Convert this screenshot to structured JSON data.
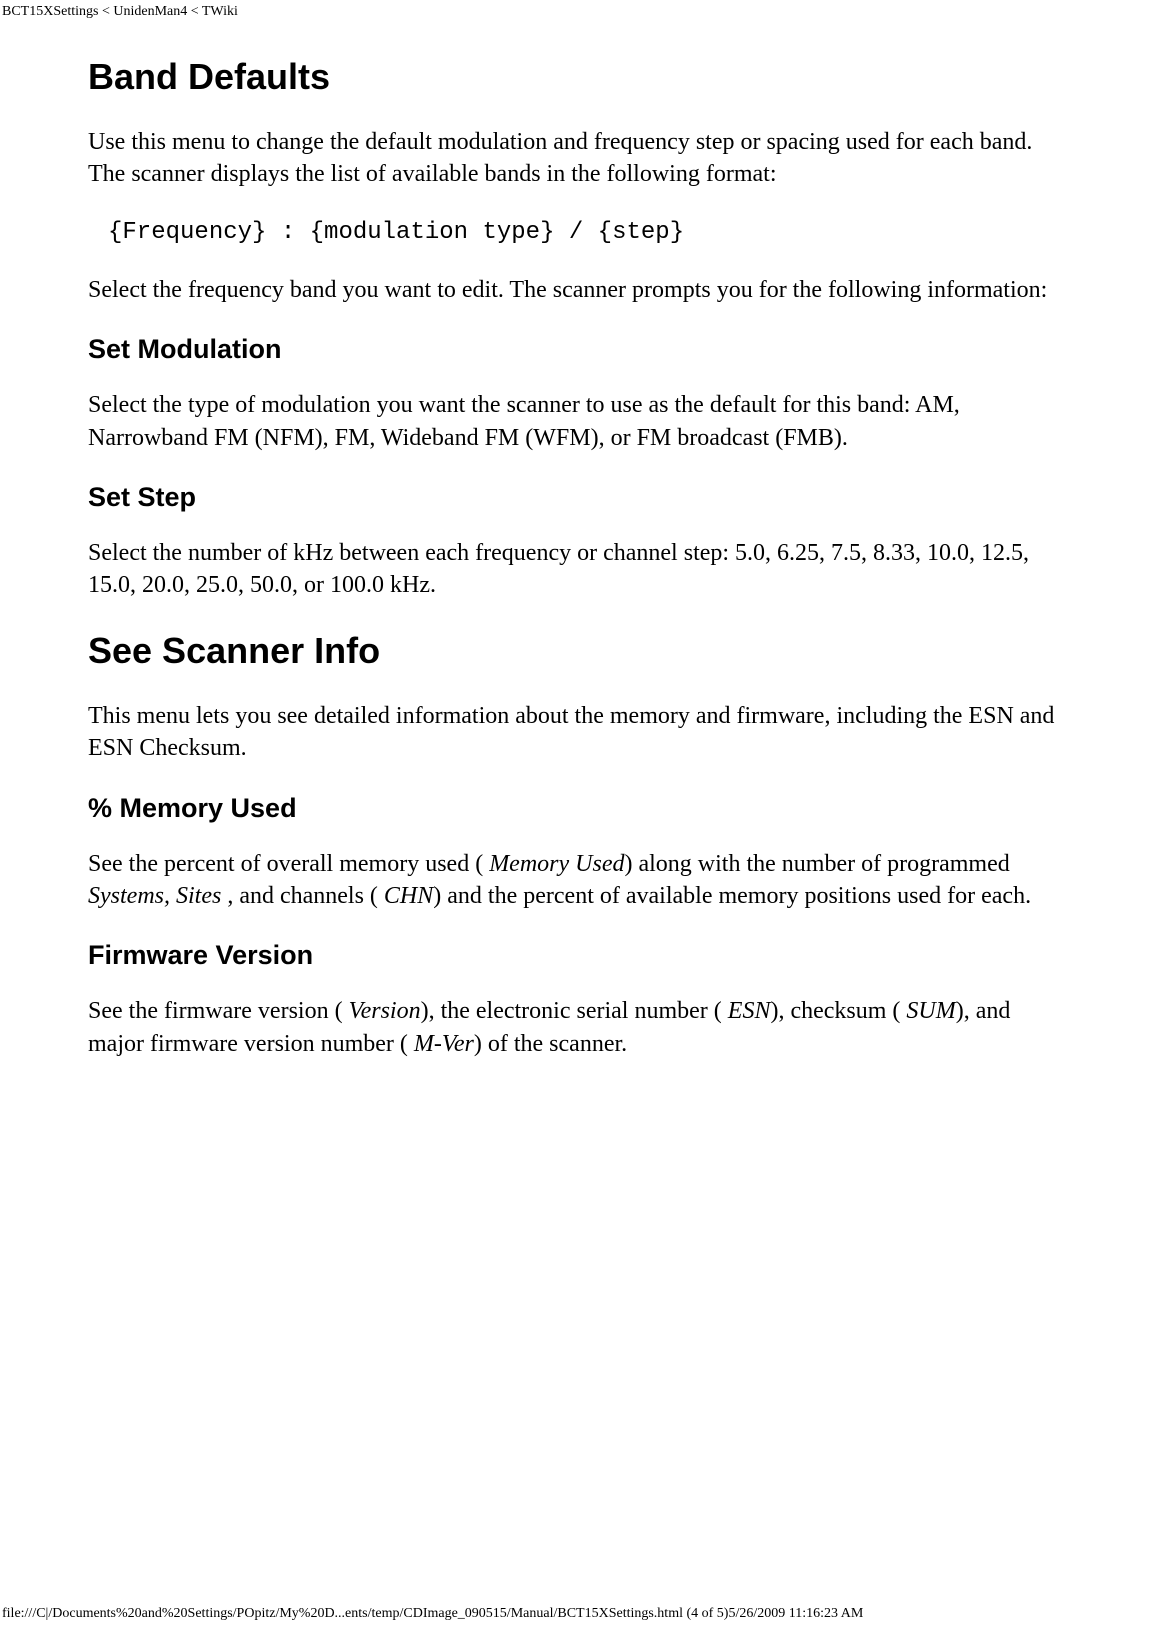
{
  "header": {
    "breadcrumb": "BCT15XSettings < UnidenMan4 < TWiki"
  },
  "sections": {
    "band_defaults": {
      "title": "Band Defaults",
      "intro": "Use this menu to change the default modulation and frequency step or spacing used for each band. The scanner displays the list of available bands in the following format:",
      "code": "{Frequency} : {modulation type} / {step}",
      "prompt": "Select the frequency band you want to edit. The scanner prompts you for the following information:",
      "set_modulation": {
        "title": "Set Modulation",
        "body": "Select the type of modulation you want the scanner to use as the default for this band: AM, Narrowband FM (NFM), FM, Wideband FM (WFM), or FM broadcast (FMB)."
      },
      "set_step": {
        "title": "Set Step",
        "body": "Select the number of kHz between each frequency or channel step: 5.0, 6.25, 7.5, 8.33, 10.0, 12.5, 15.0, 20.0, 25.0, 50.0, or 100.0 kHz."
      }
    },
    "scanner_info": {
      "title": "See Scanner Info",
      "intro": "This menu lets you see detailed information about the memory and firmware, including the ESN and ESN Checksum.",
      "memory_used": {
        "title": "% Memory Used",
        "body_parts": {
          "p1": "See the percent of overall memory used ( ",
          "e1": "Memory Used",
          "p2": ") along with the number of programmed ",
          "e2": "Systems, Sites",
          "p3": " , and channels ( ",
          "e3": "CHN",
          "p4": ") and the percent of available memory positions used for each."
        }
      },
      "firmware": {
        "title": "Firmware Version",
        "body_parts": {
          "p1": "See the firmware version ( ",
          "e1": "Version",
          "p2": "), the electronic serial number ( ",
          "e2": "ESN",
          "p3": "), checksum ( ",
          "e3": "SUM",
          "p4": "), and major firmware version number ( ",
          "e4": "M-Ver",
          "p5": ") of the scanner."
        }
      }
    }
  },
  "footer": {
    "path": "file:///C|/Documents%20and%20Settings/POpitz/My%20D...ents/temp/CDImage_090515/Manual/BCT15XSettings.html (4 of 5)5/26/2009 11:16:23 AM"
  }
}
